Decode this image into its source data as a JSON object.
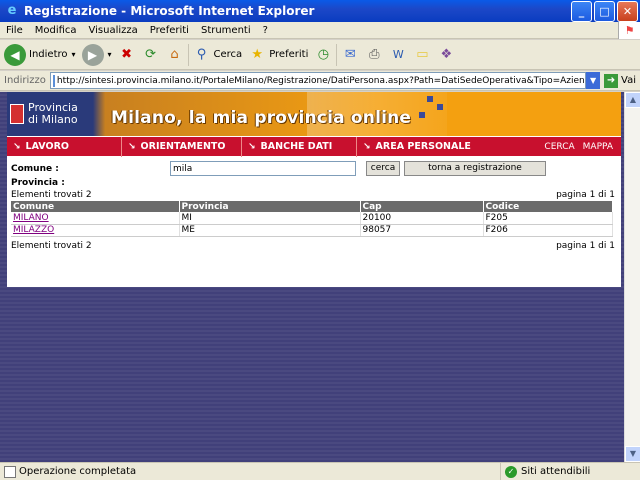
{
  "window": {
    "title": "Registrazione - Microsoft Internet Explorer",
    "minimize": "_",
    "maximize": "□",
    "close": "✕"
  },
  "menu": [
    "File",
    "Modifica",
    "Visualizza",
    "Preferiti",
    "Strumenti",
    "?"
  ],
  "toolbar": {
    "back_label": "Indietro",
    "search_label": "Cerca",
    "favorites_label": "Preferiti"
  },
  "address": {
    "label": "Indirizzo",
    "url": "http://sintesi.provincia.milano.it/PortaleMilano/Registrazione/DatiPersona.aspx?Path=DatiSedeOperativa&Tipo=Azienda&titolo=%20Az",
    "go_label": "Vai"
  },
  "site": {
    "org_line1": "Provincia",
    "org_line2": "di Milano",
    "headline": "Milano, la mia provincia online"
  },
  "nav": {
    "items": [
      "LAVORO",
      "ORIENTAMENTO",
      "BANCHE DATI",
      "AREA PERSONALE"
    ],
    "right": [
      "CERCA",
      "MAPPA"
    ]
  },
  "form": {
    "comune_label": "Comune :",
    "comune_value": "mila",
    "provincia_label": "Provincia :",
    "search_button": "cerca",
    "back_button": "torna a registrazione"
  },
  "results": {
    "found_text": "Elementi trovati 2",
    "page_text": "pagina 1 di 1",
    "columns": [
      "Comune",
      "Provincia",
      "Cap",
      "Codice"
    ],
    "rows": [
      [
        "MILANO",
        "MI",
        "20100",
        "F205"
      ],
      [
        "MILAZZO",
        "ME",
        "98057",
        "F206"
      ]
    ]
  },
  "status": {
    "text": "Operazione completata",
    "zone": "Siti attendibili"
  }
}
